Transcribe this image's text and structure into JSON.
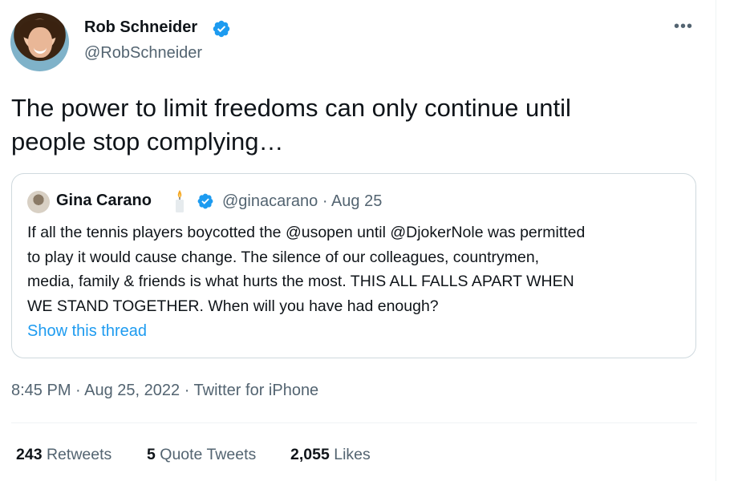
{
  "author": {
    "name": "Rob Schneider",
    "handle": "@RobSchneider",
    "verified": true
  },
  "tweet": {
    "line1": "The power to limit freedoms can only continue until",
    "line2": "people stop complying…"
  },
  "quote": {
    "name": "Gina Carano",
    "emoji": "candle",
    "verified": true,
    "handle_date": "@ginacarano · Aug 25",
    "lines": [
      "If all the tennis players boycotted the @usopen until @DjokerNole was permitted",
      "to play it would cause change. The silence of our colleagues, countrymen,",
      "media, family & friends is what hurts the most. THIS ALL FALLS APART WHEN",
      "WE STAND TOGETHER. When will you have had enough?"
    ],
    "show_thread": "Show this thread"
  },
  "timestamp": "8:45 PM · Aug 25, 2022 · Twitter for iPhone",
  "stats": {
    "retweets": {
      "count": "243",
      "label": "Retweets"
    },
    "quotes": {
      "count": "5",
      "label": "Quote Tweets"
    },
    "likes": {
      "count": "2,055",
      "label": "Likes"
    }
  },
  "colors": {
    "accent": "#1d9bf0",
    "secondary_text": "#536471",
    "border": "#cfd9de"
  },
  "icons": [
    "verified-badge-icon",
    "more-options-icon",
    "candle-emoji-icon"
  ]
}
